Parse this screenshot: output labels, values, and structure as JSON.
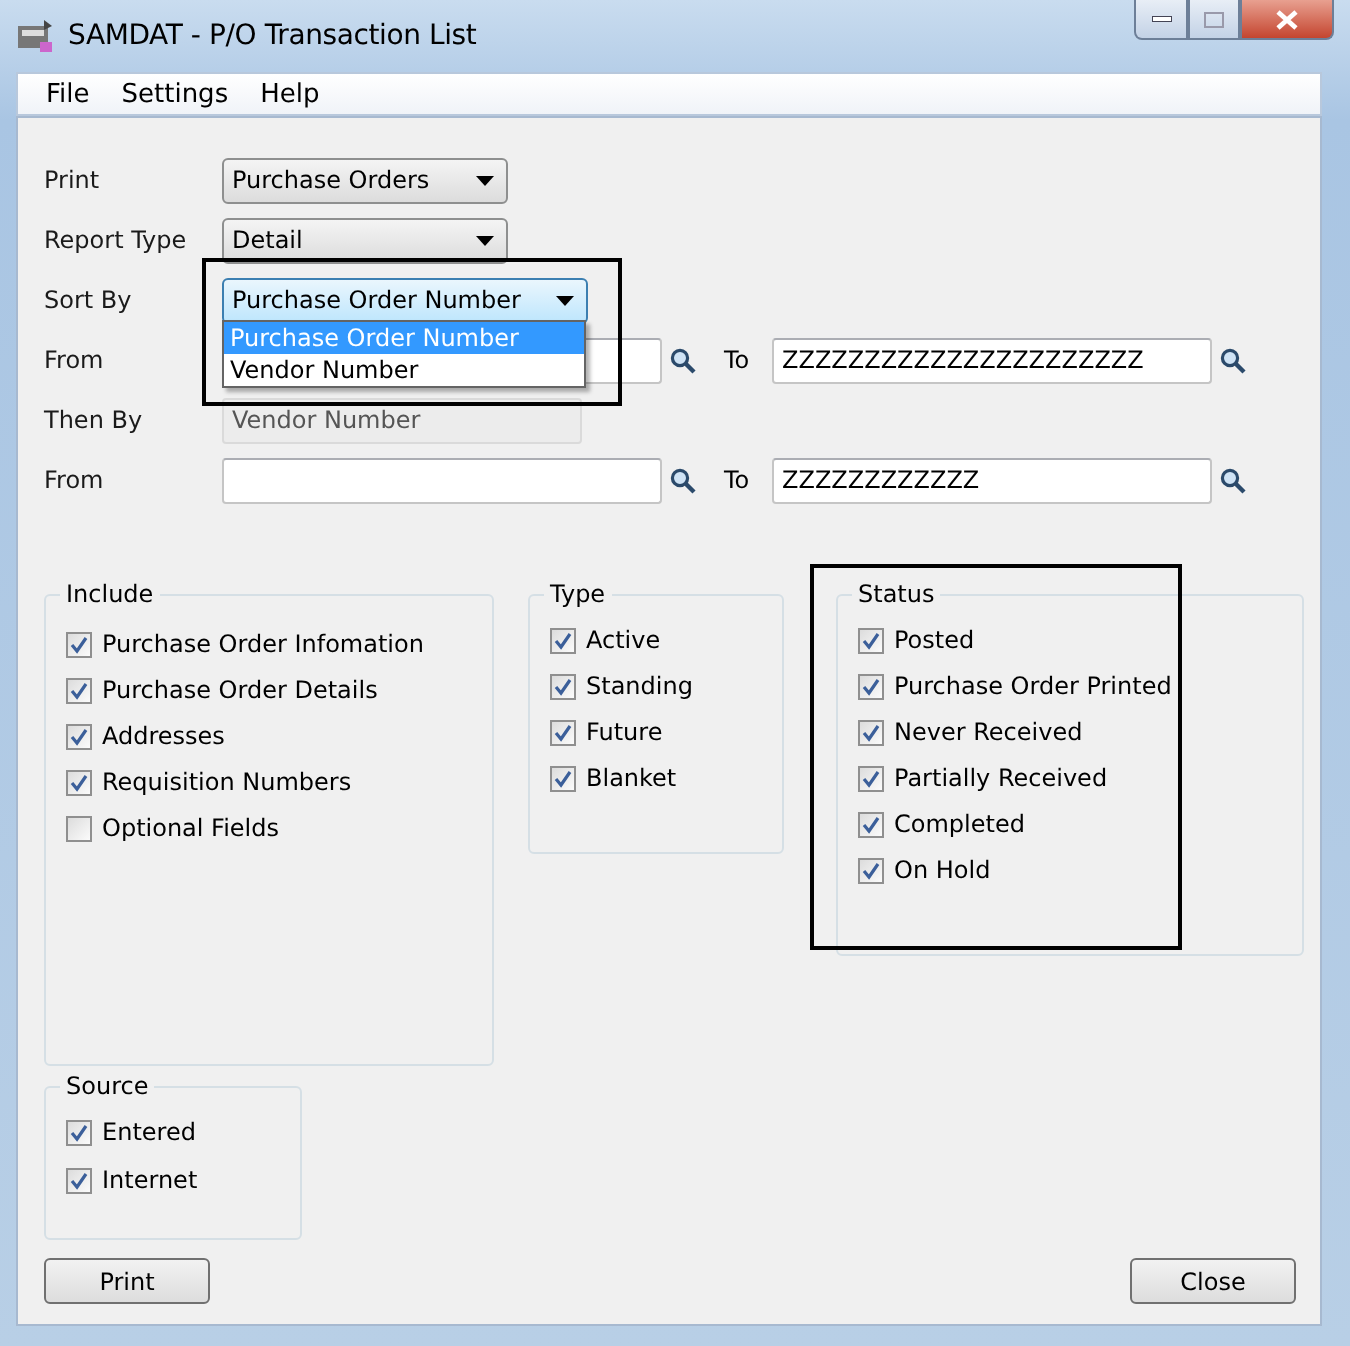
{
  "window": {
    "title": "SAMDAT - P/O Transaction List"
  },
  "menu": [
    {
      "label": "File"
    },
    {
      "label": "Settings"
    },
    {
      "label": "Help"
    }
  ],
  "selects": [
    {
      "label": "Print",
      "value": "Purchase Orders"
    },
    {
      "label": "Report Type",
      "value": "Detail"
    },
    {
      "label": "Sort By",
      "value": "Purchase Order Number",
      "expanded": true,
      "options": [
        {
          "label": "Purchase Order Number",
          "selected": true
        },
        {
          "label": "Vendor Number",
          "selected": false
        }
      ]
    }
  ],
  "range_1": {
    "from_label": "From",
    "to_label": "To",
    "to_value": "ZZZZZZZZZZZZZZZZZZZZZZ"
  },
  "then_by": {
    "label": "Then By",
    "value": "Vendor Number",
    "disabled": true
  },
  "range_2": {
    "from_label": "From",
    "to_label": "To",
    "to_value": "ZZZZZZZZZZZZ"
  },
  "groups": [
    {
      "title": "Include",
      "items": [
        {
          "label": "Purchase Order Infomation",
          "checked": true
        },
        {
          "label": "Purchase Order Details",
          "checked": true
        },
        {
          "label": "Addresses",
          "checked": true
        },
        {
          "label": "Requisition Numbers",
          "checked": true
        },
        {
          "label": "Optional Fields",
          "checked": false
        }
      ]
    },
    {
      "title": "Type",
      "items": [
        {
          "label": "Active",
          "checked": true
        },
        {
          "label": "Standing",
          "checked": true
        },
        {
          "label": "Future",
          "checked": true
        },
        {
          "label": "Blanket",
          "checked": true
        }
      ]
    },
    {
      "title": "Status",
      "items": [
        {
          "label": "Posted",
          "checked": true
        },
        {
          "label": "Purchase Order Printed",
          "checked": true
        },
        {
          "label": "Never Received",
          "checked": true
        },
        {
          "label": "Partially Received",
          "checked": true
        },
        {
          "label": "Completed",
          "checked": true
        },
        {
          "label": "On Hold",
          "checked": true
        }
      ]
    },
    {
      "title": "Source",
      "items": [
        {
          "label": "Entered",
          "checked": true
        },
        {
          "label": "Internet",
          "checked": true
        }
      ]
    }
  ],
  "buttons": [
    {
      "label": "Print"
    },
    {
      "label": "Close"
    }
  ]
}
